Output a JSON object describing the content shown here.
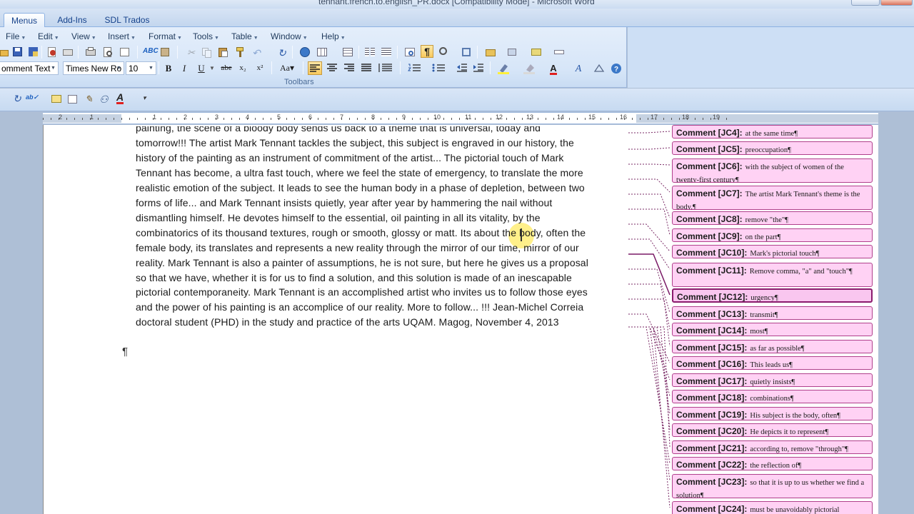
{
  "window": {
    "title": "tennant.french.to.english_PR.docx [Compatibility Mode] - Microsoft Word"
  },
  "ribbon_tabs": [
    {
      "label": "Menus",
      "active": true
    },
    {
      "label": "Add-Ins",
      "active": false
    },
    {
      "label": "SDL Trados",
      "active": false
    }
  ],
  "menus": [
    "File",
    "Edit",
    "View",
    "Insert",
    "Format",
    "Tools",
    "Table",
    "Window",
    "Help"
  ],
  "formatting": {
    "style": "omment Text",
    "font": "Times New Ro",
    "size": "10",
    "group_label": "Toolbars"
  },
  "document": {
    "lines": [
      "painting, the scene of a bloody body sends us back to a theme that is universal, today and",
      "tomorrow!!! The artist Mark Tennant tackles the subject, this subject is engraved in our history, the",
      "history of the painting as an instrument of commitment of the artist... The pictorial touch of Mark",
      "Tennant has become, a ultra fast touch, where we feel the state of emergency, to translate the more",
      "realistic emotion of the subject. It leads to see the human body in a phase of depletion, between two",
      "forms of life... and Mark Tennant insists quietly, year after year by hammering the nail without",
      "dismantling himself. He devotes himself to the essential, oil painting in all its vitality, by the",
      "combinatorics of its thousand textures, rough or smooth, glossy or matt. Its about the body, often the",
      "female body, its translates and represents a new reality through the mirror of our time, mirror of our",
      "reality. Mark Tennant is also a painter of assumptions, he is not sure, but here he gives us a proposal",
      "so that we have, whether it is for us to find a solution, and this solution is made of an inescapable",
      "pictorial contemporaneity. Mark Tennant is an accomplished artist who invites us to follow those eyes",
      "and the power of his painting is an accomplice of our reality. More to follow... !!! Jean-Michel Correia",
      "doctoral student (PHD) in the study and practice of the arts UQAM. Magog, November 4, 2013"
    ],
    "paragraph_mark": "¶"
  },
  "comments": [
    {
      "label": "Comment [JC4]:",
      "text": "at the same time¶"
    },
    {
      "label": "Comment [JC5]:",
      "text": "preoccupation¶"
    },
    {
      "label": "Comment [JC6]:",
      "text": "with the subject of women of the twenty-first century¶"
    },
    {
      "label": "Comment [JC7]:",
      "text": "The artist Mark Tennant's theme is the body,¶"
    },
    {
      "label": "Comment [JC8]:",
      "text": "remove \"the\"¶"
    },
    {
      "label": "Comment [JC9]:",
      "text": "on the part¶"
    },
    {
      "label": "Comment [JC10]:",
      "text": "Mark's pictorial touch¶"
    },
    {
      "label": "Comment [JC11]:",
      "text": "Remove comma, \"a\" and \"touch\"¶"
    },
    {
      "label": "Comment [JC12]:",
      "text": "urgency¶"
    },
    {
      "label": "Comment [JC13]:",
      "text": "transmit¶"
    },
    {
      "label": "Comment [JC14]:",
      "text": "most¶"
    },
    {
      "label": "Comment [JC15]:",
      "text": "as far as possible¶"
    },
    {
      "label": "Comment [JC16]:",
      "text": "This leads us¶"
    },
    {
      "label": "Comment [JC17]:",
      "text": "quietly insists¶"
    },
    {
      "label": "Comment [JC18]:",
      "text": "combinations¶"
    },
    {
      "label": "Comment [JC19]:",
      "text": "His subject is the body, often¶"
    },
    {
      "label": "Comment [JC20]:",
      "text": "He depicts it to represent¶"
    },
    {
      "label": "Comment [JC21]:",
      "text": "according to, remove \"through\"¶"
    },
    {
      "label": "Comment [JC22]:",
      "text": "the reflection of¶"
    },
    {
      "label": "Comment [JC23]:",
      "text": "so that it is up to us whether we find a solution¶"
    },
    {
      "label": "Comment [JC24]:",
      "text": "must be unavoidably pictorial"
    }
  ],
  "ruler": {
    "numbers": [
      "2",
      "1",
      "1",
      "2",
      "3",
      "4",
      "5",
      "6",
      "7",
      "8",
      "9",
      "10",
      "11",
      "12",
      "13",
      "14",
      "15",
      "16",
      "17",
      "18",
      "19"
    ]
  },
  "colors": {
    "comment_fill": "#ffd2f4",
    "comment_border": "#b0408c",
    "ribbon_bg": "#d7e6f8",
    "cursor_highlight": "#ffe63c"
  }
}
